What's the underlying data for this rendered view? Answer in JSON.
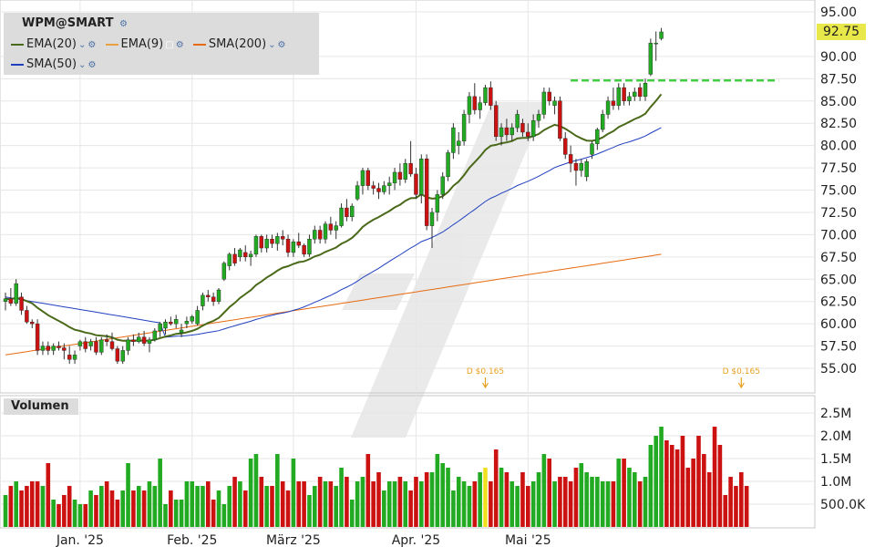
{
  "symbol_title": "WPM@SMART",
  "legend": [
    {
      "label": "EMA(20)",
      "color": "#4a6a1a"
    },
    {
      "label": "EMA(9)",
      "color": "#e8a040"
    },
    {
      "label": "SMA(200)",
      "color": "#e86a10"
    },
    {
      "label": "SMA(50)",
      "color": "#2040c0"
    }
  ],
  "volume_title": "Volumen",
  "last_price": "92.75",
  "dividend_markers": [
    {
      "label": "D $0.165",
      "date": "2025-04-01"
    },
    {
      "label": "D $0.165",
      "date": "2025-05-29"
    }
  ],
  "chart_data": {
    "type": "candlestick",
    "price_ticks": [
      "55.00",
      "57.50",
      "60.00",
      "62.50",
      "65.00",
      "67.50",
      "70.00",
      "72.50",
      "75.00",
      "77.50",
      "80.00",
      "82.50",
      "85.00",
      "87.50",
      "90.00",
      "95.00"
    ],
    "price_range": [
      53.0,
      96.0
    ],
    "volume_ticks": [
      "500.0K",
      "1.0M",
      "1.5M",
      "2.0M",
      "2.5M"
    ],
    "volume_range": [
      0,
      2.8
    ],
    "x_tick_labels": [
      "Jan. '25",
      "Feb. '25",
      "März '25",
      "Apr. '25",
      "Mai '25"
    ],
    "x_tick_index": [
      14,
      35,
      54,
      77,
      98
    ],
    "resistance_level": 87.3,
    "colors": {
      "up": "#22aa22",
      "down": "#cc1111",
      "highlight": "#f0e020"
    },
    "candles": [
      [
        62.5,
        63.5,
        61.5,
        62.8
      ],
      [
        62.8,
        64.0,
        62.0,
        62.3
      ],
      [
        62.3,
        65.0,
        62.0,
        64.5
      ],
      [
        63.0,
        63.5,
        61.0,
        61.5
      ],
      [
        61.5,
        62.0,
        60.0,
        60.2
      ],
      [
        60.2,
        60.5,
        59.5,
        60.0
      ],
      [
        60.0,
        60.5,
        56.5,
        57.0
      ],
      [
        57.0,
        58.0,
        56.5,
        57.5
      ],
      [
        57.5,
        58.0,
        56.5,
        57.0
      ],
      [
        57.0,
        57.8,
        56.5,
        57.5
      ],
      [
        57.5,
        58.0,
        57.0,
        57.3
      ],
      [
        57.3,
        57.8,
        56.0,
        57.0
      ],
      [
        56.5,
        57.5,
        55.5,
        56.0
      ],
      [
        56.0,
        57.0,
        55.5,
        56.5
      ],
      [
        57.5,
        58.2,
        57.0,
        58.0
      ],
      [
        58.0,
        58.5,
        56.8,
        57.2
      ],
      [
        57.5,
        58.3,
        57.0,
        58.0
      ],
      [
        58.0,
        58.5,
        56.5,
        56.8
      ],
      [
        56.8,
        58.5,
        56.5,
        58.2
      ],
      [
        58.2,
        58.8,
        57.5,
        58.0
      ],
      [
        58.0,
        59.0,
        57.0,
        57.2
      ],
      [
        57.2,
        57.5,
        55.5,
        55.8
      ],
      [
        55.8,
        57.5,
        55.5,
        57.0
      ],
      [
        57.0,
        58.5,
        56.5,
        58.2
      ],
      [
        58.2,
        58.8,
        57.5,
        58.0
      ],
      [
        58.0,
        59.0,
        57.8,
        58.5
      ],
      [
        58.5,
        59.2,
        57.5,
        57.8
      ],
      [
        57.8,
        58.5,
        56.8,
        58.2
      ],
      [
        58.2,
        59.5,
        58.0,
        59.2
      ],
      [
        59.2,
        60.2,
        58.5,
        60.0
      ],
      [
        59.5,
        60.5,
        58.8,
        60.2
      ],
      [
        60.2,
        60.8,
        59.8,
        60.0
      ],
      [
        60.0,
        61.0,
        59.5,
        60.5
      ],
      [
        59.0,
        60.0,
        58.5,
        59.3
      ],
      [
        60.0,
        60.8,
        59.5,
        60.3
      ],
      [
        60.3,
        61.0,
        60.0,
        60.8
      ],
      [
        60.0,
        62.0,
        59.8,
        61.5
      ],
      [
        62.0,
        63.5,
        61.5,
        63.2
      ],
      [
        63.2,
        63.8,
        62.5,
        63.0
      ],
      [
        63.0,
        63.5,
        62.0,
        62.5
      ],
      [
        62.5,
        64.0,
        62.2,
        63.8
      ],
      [
        65.0,
        67.0,
        64.8,
        66.8
      ],
      [
        66.5,
        68.0,
        66.0,
        67.8
      ],
      [
        67.8,
        68.5,
        66.5,
        66.8
      ],
      [
        67.5,
        68.5,
        67.0,
        68.3
      ],
      [
        68.0,
        68.8,
        67.0,
        67.5
      ],
      [
        67.5,
        68.2,
        66.5,
        67.8
      ],
      [
        67.8,
        70.0,
        67.5,
        69.8
      ],
      [
        69.8,
        70.0,
        68.0,
        68.5
      ],
      [
        68.5,
        70.0,
        68.0,
        69.5
      ],
      [
        69.5,
        70.0,
        68.5,
        69.0
      ],
      [
        69.0,
        70.2,
        68.2,
        69.8
      ],
      [
        69.8,
        70.5,
        68.8,
        69.5
      ],
      [
        69.5,
        70.0,
        67.5,
        68.0
      ],
      [
        68.0,
        69.5,
        67.5,
        69.2
      ],
      [
        69.2,
        70.2,
        68.5,
        68.8
      ],
      [
        68.8,
        69.0,
        67.5,
        67.8
      ],
      [
        67.8,
        70.0,
        67.5,
        69.5
      ],
      [
        69.5,
        71.0,
        69.0,
        70.5
      ],
      [
        70.5,
        71.0,
        69.0,
        69.5
      ],
      [
        69.5,
        71.5,
        69.0,
        71.2
      ],
      [
        71.2,
        72.0,
        70.0,
        70.5
      ],
      [
        70.5,
        71.5,
        69.5,
        71.0
      ],
      [
        71.0,
        73.5,
        70.8,
        73.0
      ],
      [
        73.0,
        74.0,
        71.5,
        72.0
      ],
      [
        72.0,
        73.5,
        71.5,
        73.2
      ],
      [
        74.0,
        76.0,
        73.8,
        75.5
      ],
      [
        75.5,
        77.5,
        74.5,
        77.2
      ],
      [
        77.2,
        77.5,
        75.0,
        75.5
      ],
      [
        75.5,
        76.0,
        74.5,
        75.2
      ],
      [
        75.2,
        75.8,
        74.0,
        74.8
      ],
      [
        74.8,
        76.0,
        74.5,
        75.5
      ],
      [
        75.5,
        76.5,
        74.5,
        75.8
      ],
      [
        75.8,
        77.5,
        75.0,
        77.0
      ],
      [
        77.0,
        78.0,
        75.5,
        76.2
      ],
      [
        76.2,
        78.5,
        75.8,
        78.0
      ],
      [
        78.0,
        80.5,
        76.5,
        76.8
      ],
      [
        76.8,
        77.5,
        74.0,
        74.5
      ],
      [
        74.5,
        79.0,
        73.5,
        78.5
      ],
      [
        78.5,
        79.0,
        70.5,
        71.0
      ],
      [
        71.0,
        73.0,
        68.5,
        72.5
      ],
      [
        72.5,
        75.0,
        71.5,
        74.5
      ],
      [
        74.5,
        77.0,
        74.0,
        76.5
      ],
      [
        76.5,
        79.5,
        76.0,
        79.2
      ],
      [
        79.2,
        82.5,
        78.5,
        82.0
      ],
      [
        80.0,
        81.5,
        79.0,
        80.5
      ],
      [
        80.5,
        84.0,
        80.0,
        83.5
      ],
      [
        83.5,
        86.0,
        82.5,
        85.5
      ],
      [
        85.5,
        87.0,
        83.5,
        84.0
      ],
      [
        84.0,
        85.5,
        83.0,
        84.8
      ],
      [
        84.8,
        86.8,
        84.5,
        86.5
      ],
      [
        86.5,
        87.2,
        84.0,
        84.5
      ],
      [
        84.5,
        85.0,
        80.5,
        81.0
      ],
      [
        81.0,
        82.5,
        80.0,
        82.0
      ],
      [
        82.0,
        83.0,
        80.5,
        81.2
      ],
      [
        81.2,
        82.5,
        80.5,
        82.0
      ],
      [
        82.0,
        84.0,
        81.5,
        83.5
      ],
      [
        82.5,
        83.0,
        81.0,
        81.5
      ],
      [
        81.5,
        82.5,
        80.5,
        81.0
      ],
      [
        81.0,
        83.5,
        80.5,
        82.8
      ],
      [
        82.8,
        84.0,
        82.0,
        83.5
      ],
      [
        83.5,
        86.5,
        83.0,
        86.0
      ],
      [
        86.0,
        86.5,
        84.5,
        85.0
      ],
      [
        84.5,
        85.5,
        83.5,
        85.0
      ],
      [
        85.0,
        85.5,
        80.5,
        80.8
      ],
      [
        80.8,
        81.5,
        78.5,
        79.0
      ],
      [
        79.0,
        80.0,
        77.0,
        78.0
      ],
      [
        78.0,
        78.5,
        75.5,
        77.2
      ],
      [
        77.2,
        78.5,
        76.5,
        78.0
      ],
      [
        76.5,
        78.5,
        76.0,
        78.2
      ],
      [
        79.0,
        80.5,
        78.5,
        80.2
      ],
      [
        80.2,
        82.0,
        79.5,
        81.8
      ],
      [
        81.8,
        84.0,
        81.5,
        83.5
      ],
      [
        83.5,
        85.5,
        83.0,
        85.0
      ],
      [
        85.0,
        86.5,
        84.0,
        84.5
      ],
      [
        84.5,
        87.0,
        84.0,
        86.5
      ],
      [
        86.5,
        87.0,
        84.5,
        85.0
      ],
      [
        85.0,
        86.0,
        84.5,
        85.5
      ],
      [
        85.5,
        86.5,
        85.0,
        86.0
      ],
      [
        86.5,
        87.0,
        85.0,
        85.5
      ],
      [
        85.5,
        87.5,
        85.0,
        87.0
      ],
      [
        88.0,
        92.0,
        87.8,
        91.5
      ],
      [
        91.5,
        92.8,
        89.5,
        91.5
      ],
      [
        92.0,
        93.2,
        91.8,
        92.75
      ]
    ],
    "volumes_m": [
      0.7,
      0.9,
      1.0,
      0.8,
      0.9,
      1.0,
      1.0,
      0.9,
      1.4,
      0.6,
      0.5,
      0.7,
      0.9,
      0.6,
      0.5,
      0.5,
      0.8,
      0.7,
      0.9,
      1.0,
      0.8,
      0.6,
      0.8,
      1.4,
      0.8,
      0.9,
      0.8,
      1.0,
      0.9,
      1.5,
      0.5,
      0.8,
      0.6,
      0.6,
      1.0,
      1.0,
      0.9,
      0.9,
      1.0,
      0.6,
      0.8,
      0.5,
      0.9,
      1.1,
      1.0,
      0.8,
      1.5,
      1.6,
      1.1,
      0.9,
      0.9,
      1.6,
      1.0,
      0.8,
      1.5,
      1.0,
      1.0,
      0.7,
      0.9,
      1.1,
      1.0,
      1.0,
      0.9,
      1.3,
      1.1,
      0.6,
      1.0,
      1.1,
      1.6,
      1.0,
      1.2,
      0.8,
      1.0,
      1.0,
      1.1,
      1.0,
      0.8,
      1.1,
      1.0,
      1.2,
      1.2,
      1.6,
      1.4,
      1.3,
      0.8,
      1.1,
      1.0,
      0.9,
      1.0,
      1.2,
      1.3,
      1.0,
      1.7,
      1.3,
      1.2,
      1.0,
      0.9,
      1.2,
      0.9,
      1.0,
      1.2,
      1.6,
      1.5,
      1.0,
      1.1,
      1.1,
      1.0,
      1.3,
      1.4,
      1.2,
      1.1,
      1.1,
      1.0,
      1.0,
      1.0,
      1.5,
      1.5,
      1.3,
      1.2,
      1.0,
      1.1,
      1.8,
      2.0,
      2.2,
      1.9,
      1.8,
      1.7,
      2.0,
      1.3,
      1.5,
      2.0,
      1.6,
      1.2,
      2.2,
      1.8,
      0.7,
      1.1,
      0.9,
      1.2,
      0.9
    ]
  }
}
